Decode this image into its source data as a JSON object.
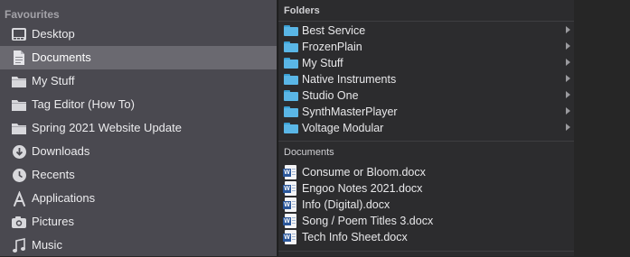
{
  "sidebar": {
    "section_title": "Favourites",
    "items": [
      {
        "label": "Desktop",
        "icon": "desktop-icon",
        "selected": false
      },
      {
        "label": "Documents",
        "icon": "documents-icon",
        "selected": true
      },
      {
        "label": "My Stuff",
        "icon": "folder-icon",
        "selected": false
      },
      {
        "label": "Tag Editor (How To)",
        "icon": "folder-icon",
        "selected": false
      },
      {
        "label": "Spring 2021 Website Update",
        "icon": "folder-icon",
        "selected": false
      },
      {
        "label": "Downloads",
        "icon": "downloads-icon",
        "selected": false
      },
      {
        "label": "Recents",
        "icon": "recents-icon",
        "selected": false
      },
      {
        "label": "Applications",
        "icon": "applications-icon",
        "selected": false
      },
      {
        "label": "Pictures",
        "icon": "pictures-icon",
        "selected": false
      },
      {
        "label": "Music",
        "icon": "music-icon",
        "selected": false
      }
    ]
  },
  "panel": {
    "folders_header": "Folders",
    "folders": [
      {
        "label": "Best Service"
      },
      {
        "label": "FrozenPlain"
      },
      {
        "label": "My Stuff"
      },
      {
        "label": "Native Instruments"
      },
      {
        "label": "Studio One"
      },
      {
        "label": "SynthMasterPlayer"
      },
      {
        "label": "Voltage Modular"
      }
    ],
    "documents_header": "Documents",
    "documents": [
      {
        "label": "Consume or Bloom.docx"
      },
      {
        "label": "Engoo Notes 2021.docx"
      },
      {
        "label": "Info (Digital).docx"
      },
      {
        "label": "Song / Poem Titles 3.docx"
      },
      {
        "label": "Tech Info Sheet.docx"
      }
    ]
  },
  "colors": {
    "sidebar_bg": "#4a4950",
    "selected_bg": "#6a6970",
    "panel_bg": "#2c2c2e",
    "folder_blue": "#5ab6e6",
    "word_blue": "#2b579a"
  }
}
